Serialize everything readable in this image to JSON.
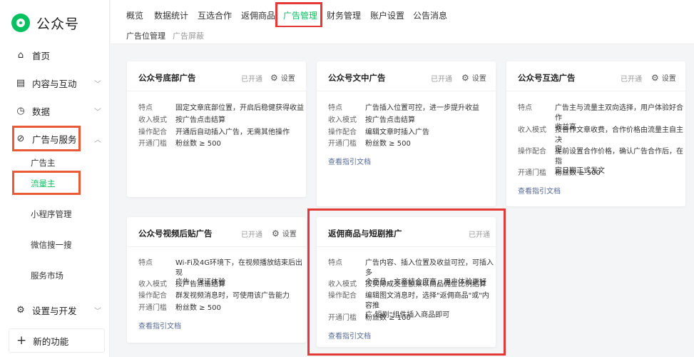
{
  "app": {
    "name": "公众号"
  },
  "sidebar": {
    "home": "首页",
    "content": "内容与互动",
    "data": "数据",
    "ads": "广告与服务",
    "ads_sub": [
      "广告主",
      "流量主"
    ],
    "mini": "小程序管理",
    "search": "微信搜一搜",
    "market": "服务市场",
    "settings": "设置与开发",
    "new_feature": "新的功能"
  },
  "tabs": [
    "概览",
    "数据统计",
    "互选合作",
    "返佣商品",
    "广告管理",
    "财务管理",
    "账户设置",
    "公告消息"
  ],
  "active_tab": "广告管理",
  "subtabs": [
    "广告位管理",
    "广告屏蔽"
  ],
  "labels": {
    "feature": "特点",
    "income": "收入模式",
    "operation": "操作配合",
    "threshold": "开通门槛",
    "settings": "设置",
    "doc_link": "查看指引文档"
  },
  "cards": [
    {
      "title": "公众号底部广告",
      "status": "已开通",
      "feature": "固定文章底部位置，开启后稳健获得收益",
      "income": "按广告点击结算",
      "operation": "开通后自动插入广告，无需其他操作",
      "threshold": "粉丝数 ≥ 500"
    },
    {
      "title": "公众号文中广告",
      "status": "已开通",
      "feature": "广告插入位置可控，进一步提升收益",
      "income": "按广告点击结算",
      "operation": "编辑文章时插入广告",
      "threshold": "粉丝数 ≥ 500"
    },
    {
      "title": "公众号互选广告",
      "status": "已开通",
      "feature_lines": [
        "广告主与流量主双向选择，用户体验好合作",
        "收益高"
      ],
      "income_lines": [
        "按合作文章收费，合作价格由流量主自主决",
        "定"
      ],
      "operation_lines": [
        "提前设置合作价格，确认广告合作后，在指",
        "定日期正式发文"
      ],
      "threshold": "粉丝数 ≥ 500"
    },
    {
      "title": "公众号视频后贴广告",
      "status": "已开通",
      "feature_lines": [
        "Wi-Fi及4G环境下，在视频播放结束后出现",
        "广告，保证体验"
      ],
      "income": "按广告点击结算",
      "operation": "群发视频消息时，可使用该广告能力",
      "threshold": "粉丝数 ≥ 500"
    },
    {
      "title": "返佣商品与短剧推广",
      "status": "已开通",
      "feature_lines": [
        "广告内容、插入位置及收益可控，可插入多",
        "个商品，文章结合度高，用户体验更好"
      ],
      "income": "按实际成交金额乘以商品佣金比例结算",
      "operation_lines": [
        "编辑图文消息时，选择\"返佣商品\"或\"内容推",
        "广-短剧\"组件插入商品即可"
      ],
      "threshold": "粉丝数 ≥ 100"
    }
  ],
  "colors": {
    "accent": "#07c160",
    "highlight": "#e53935",
    "link": "#576b95"
  }
}
